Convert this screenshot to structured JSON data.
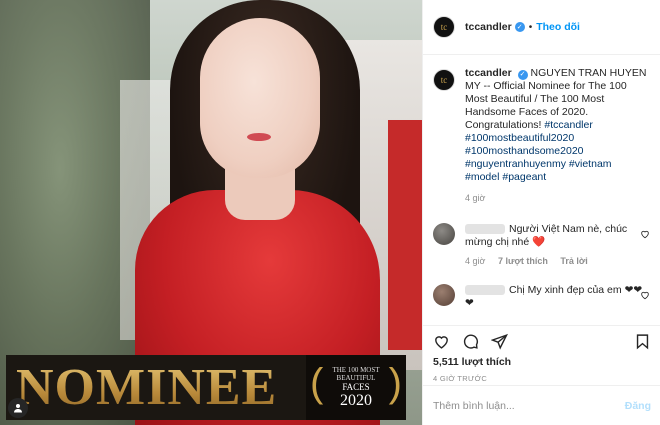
{
  "photo": {
    "nominee_text": "NOMINEE",
    "badge_line1": "THE 100 MOST",
    "badge_line2": "BEAUTIFUL",
    "badge_line3": "FACES",
    "badge_year": "2020"
  },
  "header": {
    "username": "tccandler",
    "follow_label": "Theo dõi",
    "dot": "•"
  },
  "caption": {
    "username": "tccandler",
    "text": "NGUYEN TRAN HUYEN MY -- Official Nominee for The 100 Most Beautiful / The 100 Most Handsome Faces of 2020. Congratulations!",
    "hashtags": [
      "#tccandler",
      "#100mostbeautiful2020",
      "#100mosthandsome2020",
      "#nguyentranhuyenmy",
      "#vietnam",
      "#model",
      "#pageant"
    ],
    "time": "4 giờ"
  },
  "comments": [
    {
      "text": "Người Việt Nam nè, chúc mừng chị nhé",
      "emoji": "❤️",
      "time": "4 giờ",
      "likes": "7 lượt thích",
      "reply": "Trả lời"
    },
    {
      "text": "Chị My xinh đẹp của em",
      "emoji": "❤❤❤"
    }
  ],
  "actions": {
    "likes": "5,511 lượt thích",
    "posted": "4 GIỜ TRƯỚC"
  },
  "add_comment": {
    "placeholder": "Thêm bình luận...",
    "post_label": "Đăng"
  },
  "colors": {
    "accent": "#0095f6",
    "verified": "#3897f0",
    "gold": "#c9a24a",
    "hashtag": "#00376b"
  }
}
